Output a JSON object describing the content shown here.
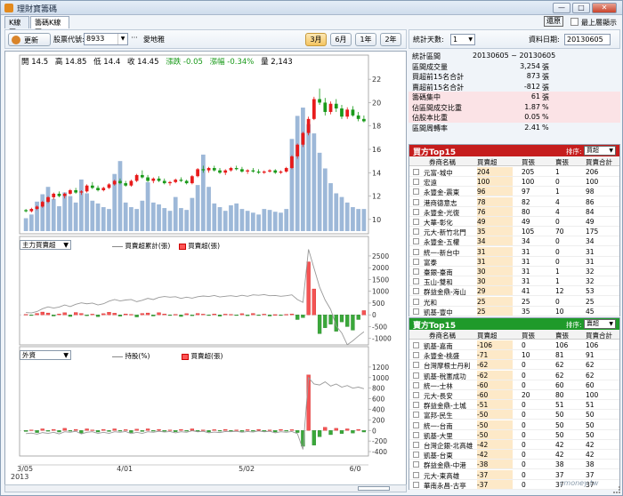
{
  "window": {
    "title": "理財寶籌碼",
    "min": "—",
    "max": "□",
    "close": "✕"
  },
  "tabs": [
    "K線圖",
    "籌碼K線圖"
  ],
  "topright": {
    "restore_label": "還原",
    "always_top_label": "最上層顯示"
  },
  "toolbar": {
    "update_label": "更新",
    "code_label": "股票代號:",
    "code_value": "8933",
    "dots": "···",
    "stock_name": "愛地雅",
    "periods": [
      "3月",
      "6月",
      "1年",
      "2年"
    ],
    "active_period": "3月"
  },
  "ohlc": {
    "open": "開 14.5",
    "high": "高 14.85",
    "low": "低 14.4",
    "close": "收 14.45",
    "change": "漲跌 -0.05",
    "pct": "漲幅 -0.34%",
    "vol": "量 2,143"
  },
  "panels": {
    "p2": {
      "select": "主力買賣超",
      "legend_line": "買賣超累計(張)",
      "legend_bar": "買賣超(張)"
    },
    "p3": {
      "select": "外資",
      "legend_line": "持股(%)",
      "legend_bar": "買賣超(張)"
    }
  },
  "info_top": {
    "days_label": "統計天數:",
    "days_value": "1",
    "date_label": "資料日期:",
    "date_value": "20130605"
  },
  "stats": [
    {
      "k": "統計區間",
      "full": "20130605 ~ 20130605"
    },
    {
      "k": "區間成交量",
      "v": "3,254",
      "u": "張"
    },
    {
      "k": "買超前15名合計",
      "v": "873",
      "u": "張"
    },
    {
      "k": "賣超前15名合計",
      "v": "-812",
      "u": "張"
    },
    {
      "k": "籌碼集中",
      "v": "61",
      "u": "張",
      "pink": true
    },
    {
      "k": "佔區間成交比重",
      "v": "1.87",
      "u": "%",
      "pink": true
    },
    {
      "k": "佔股本比重",
      "v": "0.05",
      "u": "%",
      "pink": true
    },
    {
      "k": "區間周轉率",
      "v": "2.41",
      "u": "%"
    }
  ],
  "buy_table": {
    "title": "買方Top15",
    "sort_label": "排序:",
    "sort_value": "買超",
    "headers": [
      "券商名稱",
      "買賣超",
      "買張",
      "賣張",
      "買賣合計"
    ],
    "rows": [
      [
        "元富-城中",
        "204",
        "205",
        "1",
        "206"
      ],
      [
        "宏遠",
        "100",
        "100",
        "0",
        "100"
      ],
      [
        "永豐金-震東",
        "96",
        "97",
        "1",
        "98"
      ],
      [
        "港商德意志",
        "78",
        "82",
        "4",
        "86"
      ],
      [
        "永豐金-光復",
        "76",
        "80",
        "4",
        "84"
      ],
      [
        "大華-彰化",
        "49",
        "49",
        "0",
        "49"
      ],
      [
        "元大-新竹北門",
        "35",
        "105",
        "70",
        "175"
      ],
      [
        "永豐金-五權",
        "34",
        "34",
        "0",
        "34"
      ],
      [
        "統一-新台中",
        "31",
        "31",
        "0",
        "31"
      ],
      [
        "富泰",
        "31",
        "31",
        "0",
        "31"
      ],
      [
        "臺銀-臺南",
        "30",
        "31",
        "1",
        "32"
      ],
      [
        "玉山-雙和",
        "30",
        "31",
        "1",
        "32"
      ],
      [
        "群益金鼎-海山",
        "29",
        "41",
        "12",
        "53"
      ],
      [
        "光和",
        "25",
        "25",
        "0",
        "25"
      ],
      [
        "凱基-豐中",
        "25",
        "35",
        "10",
        "45"
      ]
    ]
  },
  "sell_table": {
    "title": "賣方Top15",
    "sort_label": "排序:",
    "sort_value": "賣超",
    "headers": [
      "券商名稱",
      "買賣超",
      "買張",
      "賣張",
      "買賣合計"
    ],
    "rows": [
      [
        "凱基-嘉南",
        "-106",
        "0",
        "106",
        "106"
      ],
      [
        "永豐金-桃盛",
        "-71",
        "10",
        "81",
        "91"
      ],
      [
        "台灣摩根士丹利",
        "-62",
        "0",
        "62",
        "62"
      ],
      [
        "凱基-稅憲成功",
        "-62",
        "0",
        "62",
        "62"
      ],
      [
        "統一-士林",
        "-60",
        "0",
        "60",
        "60"
      ],
      [
        "元大-長安",
        "-60",
        "20",
        "80",
        "100"
      ],
      [
        "群益金鼎-土城",
        "-51",
        "0",
        "51",
        "51"
      ],
      [
        "富邦-民生",
        "-50",
        "0",
        "50",
        "50"
      ],
      [
        "統一-台南",
        "-50",
        "0",
        "50",
        "50"
      ],
      [
        "凱基-大里",
        "-50",
        "0",
        "50",
        "50"
      ],
      [
        "台灣企銀-北高雄",
        "-42",
        "0",
        "42",
        "42"
      ],
      [
        "凱基-台東",
        "-42",
        "0",
        "42",
        "42"
      ],
      [
        "群益金鼎-中港",
        "-38",
        "0",
        "38",
        "38"
      ],
      [
        "元大-東高雄",
        "-37",
        "0",
        "37",
        "37"
      ],
      [
        "華南永昌-古亭",
        "-37",
        "0",
        "37",
        "37"
      ]
    ]
  },
  "watermark": "cmoney.tw",
  "chart_data": [
    {
      "type": "candlestick",
      "yticks": [
        10,
        12,
        14,
        16,
        18,
        20,
        22
      ],
      "ylim": [
        9,
        23
      ],
      "xticks": [
        "3/05",
        "4/01",
        "5/02",
        "6/0"
      ],
      "xsub": "2013",
      "candles": [
        [
          10.8,
          10.9,
          10.6,
          10.7
        ],
        [
          10.7,
          11.0,
          10.6,
          10.9
        ],
        [
          10.9,
          11.2,
          10.8,
          11.1
        ],
        [
          11.1,
          11.6,
          11.0,
          11.5
        ],
        [
          11.5,
          12.0,
          11.4,
          11.9
        ],
        [
          11.9,
          12.3,
          11.7,
          12.2
        ],
        [
          12.2,
          12.4,
          11.9,
          12.0
        ],
        [
          12.0,
          12.3,
          11.8,
          12.2
        ],
        [
          12.2,
          12.6,
          12.1,
          12.5
        ],
        [
          12.5,
          12.7,
          12.2,
          12.3
        ],
        [
          12.3,
          12.5,
          12.1,
          12.4
        ],
        [
          12.4,
          13.0,
          12.3,
          12.9
        ],
        [
          12.9,
          13.2,
          12.6,
          12.7
        ],
        [
          12.7,
          12.9,
          12.4,
          12.5
        ],
        [
          12.5,
          12.8,
          12.4,
          12.7
        ],
        [
          12.7,
          13.1,
          12.6,
          13.0
        ],
        [
          13.0,
          13.4,
          12.9,
          13.3
        ],
        [
          13.3,
          13.5,
          13.0,
          13.1
        ],
        [
          13.1,
          13.3,
          12.8,
          12.9
        ],
        [
          12.9,
          13.4,
          12.8,
          13.3
        ],
        [
          13.3,
          13.9,
          13.2,
          13.8
        ],
        [
          13.8,
          14.2,
          13.5,
          13.6
        ],
        [
          13.6,
          13.8,
          13.2,
          13.3
        ],
        [
          13.3,
          13.6,
          13.1,
          13.5
        ],
        [
          13.5,
          13.7,
          13.2,
          13.3
        ],
        [
          13.3,
          13.5,
          13.0,
          13.1
        ],
        [
          13.1,
          13.3,
          12.9,
          13.2
        ],
        [
          13.2,
          13.5,
          13.1,
          13.4
        ],
        [
          13.4,
          13.6,
          13.2,
          13.3
        ],
        [
          13.3,
          13.4,
          13.0,
          13.1
        ],
        [
          13.1,
          13.8,
          13.0,
          13.7
        ],
        [
          13.7,
          14.4,
          13.6,
          14.3
        ],
        [
          14.3,
          14.6,
          14.0,
          14.2
        ],
        [
          14.2,
          14.5,
          14.0,
          14.4
        ],
        [
          14.4,
          14.6,
          14.1,
          14.2
        ],
        [
          14.2,
          14.4,
          13.9,
          14.0
        ],
        [
          14.0,
          14.3,
          13.8,
          14.2
        ],
        [
          14.2,
          14.5,
          14.1,
          14.4
        ],
        [
          14.4,
          14.6,
          14.2,
          14.3
        ],
        [
          14.3,
          14.5,
          14.0,
          14.1
        ],
        [
          14.1,
          14.3,
          13.9,
          14.2
        ],
        [
          14.2,
          14.4,
          14.0,
          14.1
        ],
        [
          14.1,
          14.3,
          13.9,
          14.0
        ],
        [
          14.0,
          14.2,
          13.9,
          14.1
        ],
        [
          14.1,
          14.3,
          14.0,
          14.2
        ],
        [
          14.2,
          14.3,
          13.9,
          14.0
        ],
        [
          14.0,
          14.2,
          13.9,
          14.1
        ],
        [
          14.1,
          14.5,
          14.0,
          14.4
        ],
        [
          14.4,
          15.5,
          14.3,
          15.4
        ],
        [
          15.4,
          16.5,
          15.2,
          16.4
        ],
        [
          16.4,
          17.5,
          16.2,
          17.4
        ],
        [
          17.4,
          18.8,
          17.2,
          18.6
        ],
        [
          18.6,
          20.5,
          18.5,
          20.3
        ],
        [
          20.3,
          21.2,
          19.8,
          20.0
        ],
        [
          20.0,
          20.4,
          18.9,
          19.2
        ],
        [
          19.2,
          20.1,
          19.0,
          19.9
        ],
        [
          19.9,
          20.3,
          19.2,
          19.5
        ],
        [
          19.5,
          19.8,
          18.6,
          18.8
        ],
        [
          18.8,
          19.6,
          18.6,
          19.4
        ],
        [
          19.4,
          19.7,
          18.8,
          18.9
        ],
        [
          18.9,
          19.2,
          18.4,
          18.6
        ],
        [
          18.6,
          18.9,
          18.3,
          18.4
        ]
      ],
      "volumes": [
        1.4,
        1.8,
        3.2,
        4.0,
        4.8,
        3.5,
        2.7,
        4.2,
        3.8,
        3.1,
        5.6,
        4.1,
        3.3,
        3.0,
        2.6,
        2.4,
        6.2,
        7.6,
        3.1,
        2.6,
        2.4,
        3.3,
        5.3,
        3.1,
        2.9,
        2.5,
        2.2,
        3.7,
        2.5,
        2.3,
        3.6,
        5.0,
        8.3,
        4.8,
        3.0,
        2.6,
        2.2,
        2.8,
        3.0,
        2.4,
        2.2,
        2.0,
        1.8,
        2.4,
        2.3,
        2.1,
        2.0,
        2.4,
        10.0,
        12.5,
        13.4,
        11.6,
        10.6,
        8.5,
        6.8,
        5.2,
        4.1,
        3.7,
        3.1,
        2.6,
        2.4,
        2.4
      ]
    },
    {
      "type": "bar+line",
      "yticks": [
        -1000,
        -500,
        0,
        500,
        1000,
        1500,
        2000,
        2500
      ],
      "ylim": [
        -1200,
        2800
      ],
      "bars": [
        20,
        -30,
        60,
        120,
        80,
        -50,
        40,
        90,
        -70,
        100,
        60,
        -40,
        30,
        -80,
        50,
        110,
        70,
        -60,
        40,
        20,
        -90,
        60,
        80,
        -50,
        90,
        40,
        -30,
        20,
        -70,
        50,
        -40,
        60,
        30,
        -20,
        40,
        -60,
        30,
        20,
        -30,
        50,
        -40,
        60,
        -20,
        30,
        -50,
        10,
        -30,
        20,
        40,
        -200,
        -120,
        2250,
        1100,
        -800,
        -550,
        -400,
        -700,
        -300,
        -500,
        -650,
        -200,
        180
      ],
      "line": [
        100,
        80,
        140,
        260,
        340,
        290,
        330,
        420,
        350,
        450,
        510,
        470,
        500,
        420,
        470,
        580,
        650,
        590,
        630,
        650,
        560,
        620,
        700,
        650,
        740,
        780,
        750,
        770,
        700,
        750,
        710,
        770,
        800,
        780,
        820,
        760,
        790,
        810,
        780,
        830,
        790,
        850,
        830,
        860,
        810,
        820,
        790,
        810,
        850,
        650,
        530,
        2780,
        1980,
        1180,
        630,
        230,
        -470,
        -770,
        -1270,
        -1100,
        -900,
        -720
      ]
    },
    {
      "type": "bar+line",
      "yticks": [
        -400,
        -200,
        0,
        200,
        400,
        600,
        800,
        1000,
        1200
      ],
      "ylim": [
        -450,
        1350
      ],
      "bars": [
        -20,
        10,
        -40,
        30,
        -15,
        20,
        -30,
        40,
        -10,
        20,
        -50,
        30,
        10,
        -30,
        20,
        -20,
        30,
        -10,
        15,
        -40,
        25,
        -20,
        30,
        -10,
        20,
        -15,
        10,
        -25,
        20,
        -10,
        30,
        -20,
        10,
        -30,
        15,
        -10,
        20,
        -5,
        10,
        -20,
        15,
        -10,
        20,
        -15,
        10,
        -30,
        20,
        -10,
        15,
        -40,
        -300,
        1050,
        -280,
        -120,
        60,
        -80,
        40,
        -60,
        30,
        -50,
        20,
        -30
      ],
      "line": [
        -60,
        -50,
        -70,
        -40,
        -55,
        -35,
        -65,
        -25,
        -35,
        -15,
        -65,
        -35,
        -25,
        -55,
        -35,
        -55,
        -25,
        -35,
        -20,
        -60,
        -35,
        -55,
        -25,
        -35,
        -15,
        -30,
        -20,
        -45,
        -25,
        -35,
        -5,
        -25,
        -15,
        -45,
        -30,
        -40,
        -20,
        -25,
        -15,
        -35,
        -20,
        -30,
        -10,
        -25,
        -15,
        -45,
        -25,
        -35,
        -20,
        -60,
        -360,
        1000,
        880,
        860,
        920,
        840,
        880,
        820,
        850,
        800,
        820,
        790
      ]
    }
  ]
}
